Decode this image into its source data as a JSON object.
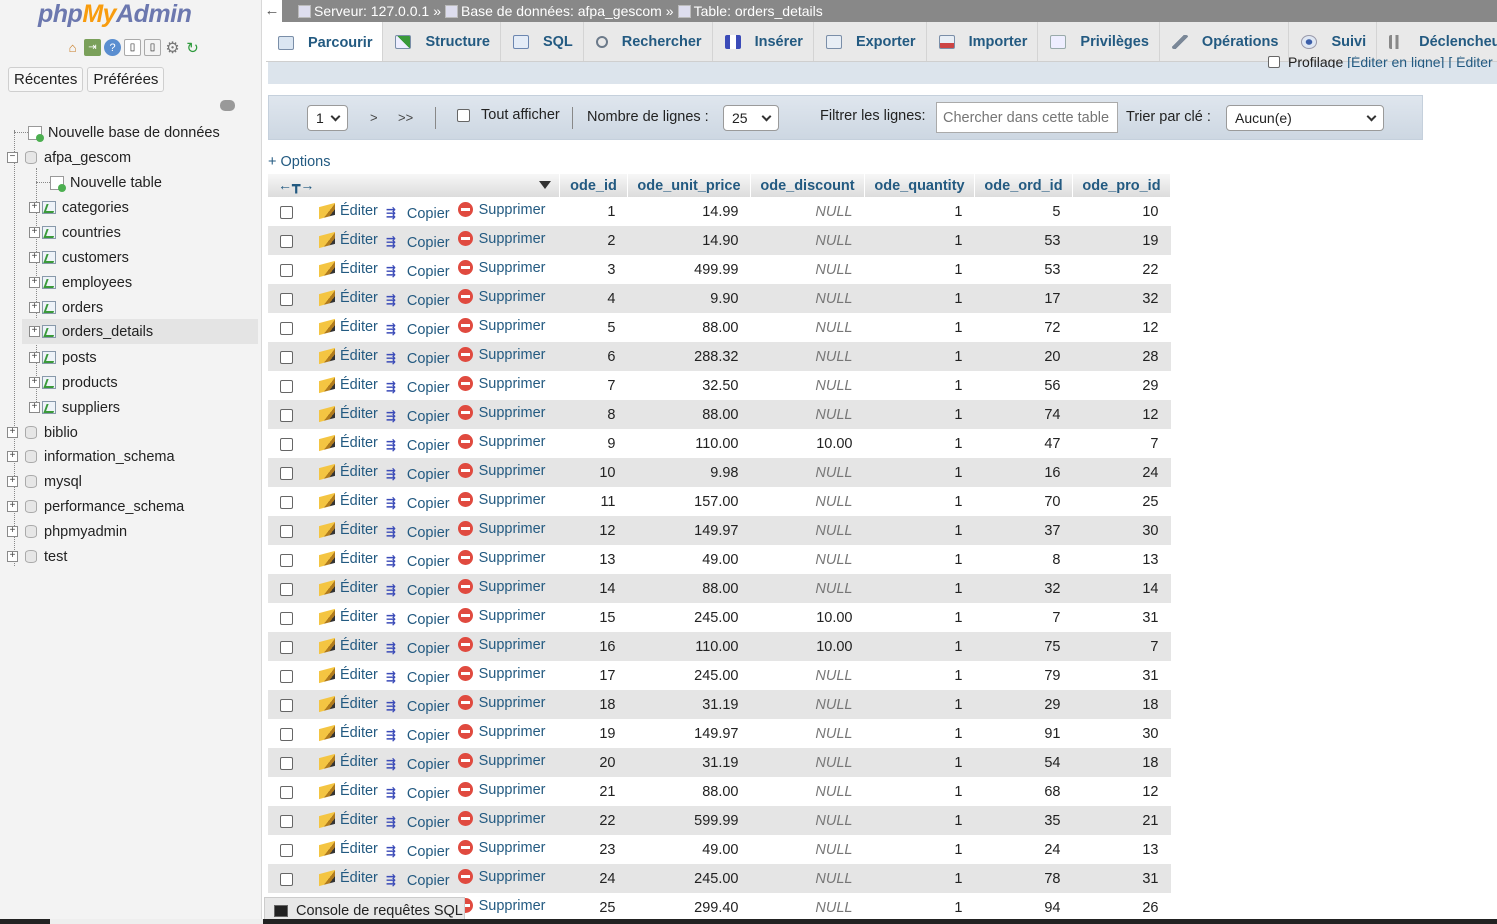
{
  "app": {
    "logo_php": "php",
    "logo_my": "My",
    "logo_admin": "Admin"
  },
  "nav": {
    "recent_label": "Récentes",
    "favorites_label": "Préférées",
    "tree": {
      "new_database": "Nouvelle base de données",
      "current_db": "afpa_gescom",
      "new_table": "Nouvelle table",
      "tables": [
        "categories",
        "countries",
        "customers",
        "employees",
        "orders",
        "orders_details",
        "posts",
        "products",
        "suppliers"
      ],
      "selected_table": "orders_details",
      "other_dbs": [
        "biblio",
        "information_schema",
        "mysql",
        "performance_schema",
        "phpmyadmin",
        "test"
      ]
    }
  },
  "breadcrumb": {
    "server": "Serveur: 127.0.0.1",
    "database": "Base de données: afpa_gescom",
    "table": "Table: orders_details",
    "separator": "»"
  },
  "tabs": [
    {
      "label": "Parcourir",
      "icon": "browse-icon",
      "active": true
    },
    {
      "label": "Structure",
      "icon": "structure-icon"
    },
    {
      "label": "SQL",
      "icon": "sql-icon"
    },
    {
      "label": "Rechercher",
      "icon": "search-icon"
    },
    {
      "label": "Insérer",
      "icon": "insert-icon"
    },
    {
      "label": "Exporter",
      "icon": "export-icon"
    },
    {
      "label": "Importer",
      "icon": "import-icon"
    },
    {
      "label": "Privilèges",
      "icon": "privileges-icon"
    },
    {
      "label": "Opérations",
      "icon": "wrench-icon"
    },
    {
      "label": "Suivi",
      "icon": "eye-icon"
    },
    {
      "label": "Déclencheurs",
      "icon": "triggers-icon"
    }
  ],
  "profiling": {
    "label": "Profilage",
    "edit_inline": "[Éditer en ligne]",
    "edit": "[ Éditer"
  },
  "toolbar": {
    "page": "1",
    "next": ">",
    "last": ">>",
    "show_all": "Tout afficher",
    "rows_label": "Nombre de lignes :",
    "rows_value": "25",
    "filter_label": "Filtrer les lignes:",
    "filter_placeholder": "Chercher dans cette table",
    "sort_label": "Trier par clé :",
    "sort_value": "Aucun(e)"
  },
  "options_link": "+ Options",
  "table": {
    "columns": [
      "ode_id",
      "ode_unit_price",
      "ode_discount",
      "ode_quantity",
      "ode_ord_id",
      "ode_pro_id"
    ],
    "actions": {
      "edit": "Éditer",
      "copy": "Copier",
      "delete": "Supprimer"
    },
    "rows": [
      [
        "1",
        "14.99",
        "NULL",
        "1",
        "5",
        "10"
      ],
      [
        "2",
        "14.90",
        "NULL",
        "1",
        "53",
        "19"
      ],
      [
        "3",
        "499.99",
        "NULL",
        "1",
        "53",
        "22"
      ],
      [
        "4",
        "9.90",
        "NULL",
        "1",
        "17",
        "32"
      ],
      [
        "5",
        "88.00",
        "NULL",
        "1",
        "72",
        "12"
      ],
      [
        "6",
        "288.32",
        "NULL",
        "1",
        "20",
        "28"
      ],
      [
        "7",
        "32.50",
        "NULL",
        "1",
        "56",
        "29"
      ],
      [
        "8",
        "88.00",
        "NULL",
        "1",
        "74",
        "12"
      ],
      [
        "9",
        "110.00",
        "10.00",
        "1",
        "47",
        "7"
      ],
      [
        "10",
        "9.98",
        "NULL",
        "1",
        "16",
        "24"
      ],
      [
        "11",
        "157.00",
        "NULL",
        "1",
        "70",
        "25"
      ],
      [
        "12",
        "149.97",
        "NULL",
        "1",
        "37",
        "30"
      ],
      [
        "13",
        "49.00",
        "NULL",
        "1",
        "8",
        "13"
      ],
      [
        "14",
        "88.00",
        "NULL",
        "1",
        "32",
        "14"
      ],
      [
        "15",
        "245.00",
        "10.00",
        "1",
        "7",
        "31"
      ],
      [
        "16",
        "110.00",
        "10.00",
        "1",
        "75",
        "7"
      ],
      [
        "17",
        "245.00",
        "NULL",
        "1",
        "79",
        "31"
      ],
      [
        "18",
        "31.19",
        "NULL",
        "1",
        "29",
        "18"
      ],
      [
        "19",
        "149.97",
        "NULL",
        "1",
        "91",
        "30"
      ],
      [
        "20",
        "31.19",
        "NULL",
        "1",
        "54",
        "18"
      ],
      [
        "21",
        "88.00",
        "NULL",
        "1",
        "68",
        "12"
      ],
      [
        "22",
        "599.99",
        "NULL",
        "1",
        "35",
        "21"
      ],
      [
        "23",
        "49.00",
        "NULL",
        "1",
        "24",
        "13"
      ],
      [
        "24",
        "245.00",
        "NULL",
        "1",
        "78",
        "31"
      ],
      [
        "25",
        "299.40",
        "NULL",
        "1",
        "94",
        "26"
      ]
    ]
  },
  "console": {
    "label": "Console de requêtes SQL"
  },
  "colors": {
    "link": "#235a81",
    "logo_blue": "#6c78af",
    "logo_orange": "#f89c0e",
    "even_row": "#e5e5e5",
    "topbar": "#888888"
  }
}
